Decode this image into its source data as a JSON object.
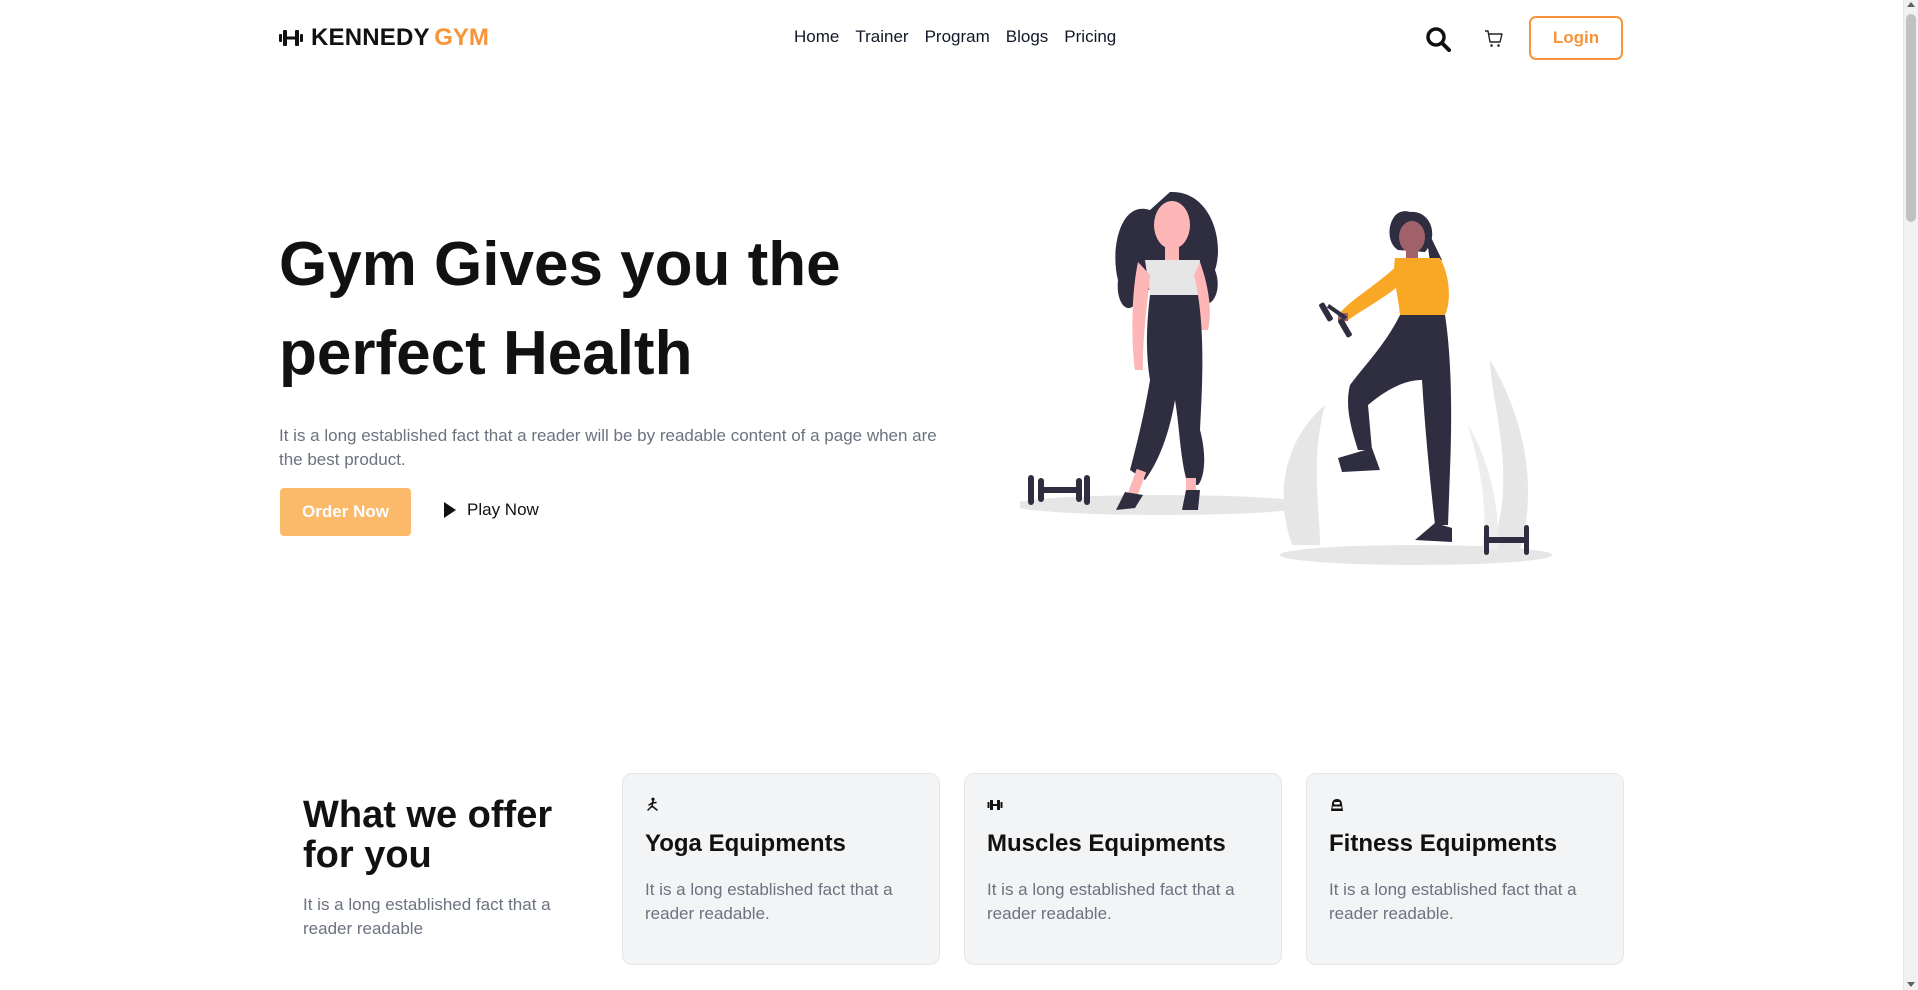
{
  "header": {
    "logo_text": "KENNEDY",
    "logo_accent": "GYM",
    "nav": [
      "Home",
      "Trainer",
      "Program",
      "Blogs",
      "Pricing"
    ],
    "login_label": "Login"
  },
  "hero": {
    "title": "Gym Gives you the perfect Health",
    "description": "It is a long established fact that a reader will be by readable content of a page when are the best product.",
    "order_label": "Order Now",
    "play_label": "Play Now"
  },
  "offer": {
    "title": "What we offer for you",
    "description": "It is a long established fact that a reader readable",
    "cards": [
      {
        "icon": "yoga-icon",
        "title": "Yoga Equipments",
        "description": "It is a long established fact that a reader readable."
      },
      {
        "icon": "dumbbell-icon",
        "title": "Muscles Equipments",
        "description": "It is a long established fact that a reader readable."
      },
      {
        "icon": "fitness-icon",
        "title": "Fitness Equipments",
        "description": "It is a long established fact that a reader readable."
      }
    ]
  },
  "colors": {
    "accent": "#f7943a",
    "button_fill": "#fbb96a",
    "text_dark": "#111827",
    "text_muted": "#6b7280",
    "card_bg": "#f3f4f6"
  }
}
